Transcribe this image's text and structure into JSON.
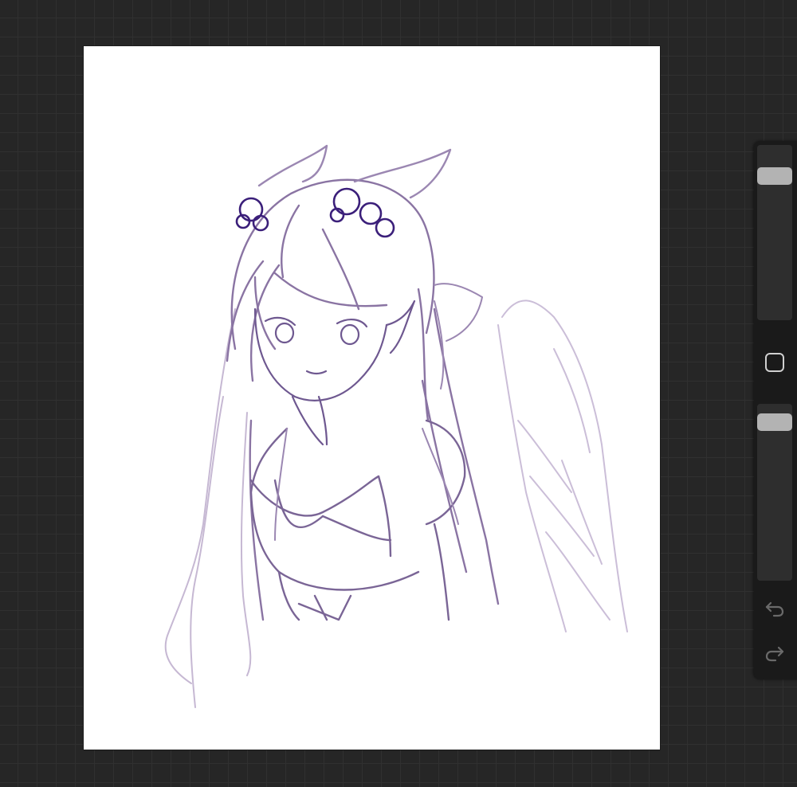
{
  "app": {
    "canvas": {
      "background_color": "#ffffff",
      "sketch_color": "#5a3d85",
      "accent_color": "#3b1f7a"
    },
    "sidebar": {
      "brush_size": {
        "value": 0.86
      },
      "modify_button": {
        "icon": "square-icon"
      },
      "opacity": {
        "value": 0.94
      },
      "undo": {
        "icon": "undo-arrow-icon"
      },
      "redo": {
        "icon": "redo-arrow-icon"
      }
    }
  }
}
